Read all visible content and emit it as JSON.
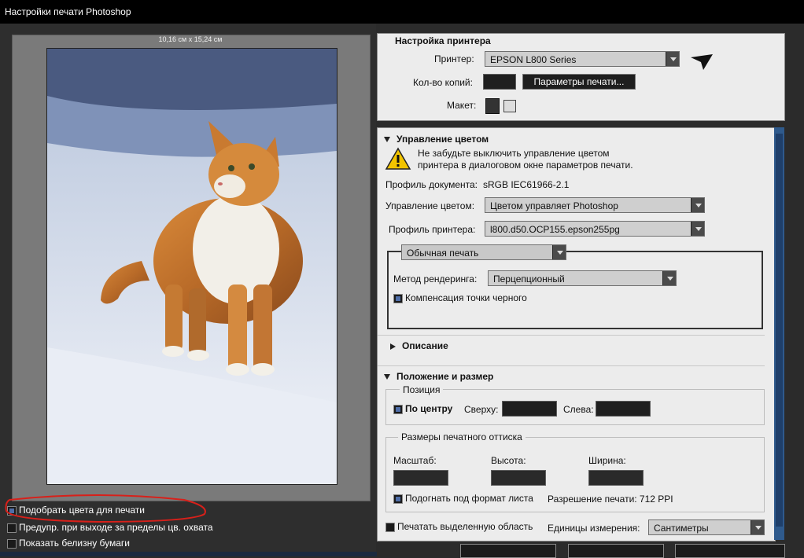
{
  "window": {
    "title": "Настройки печати Photoshop"
  },
  "preview": {
    "size_label": "10,16 см х 15,24 см"
  },
  "left_options": [
    {
      "label": "Подобрать цвета для печати",
      "checked": true
    },
    {
      "label": "Предупр. при выходе за пределы цв. охвата",
      "checked": false
    },
    {
      "label": "Показать белизну бумаги",
      "checked": false
    }
  ],
  "printer_setup": {
    "title": "Настройка принтера",
    "printer_label": "Принтер:",
    "printer_value": "EPSON L800 Series",
    "copies_label": "Кол-во копий:",
    "copies_value": "",
    "print_settings_button": "Параметры печати...",
    "layout_label": "Макет:"
  },
  "color_management": {
    "title": "Управление цветом",
    "warning": [
      "Не забудьте выключить управление цветом",
      "принтера в диалоговом окне параметров печати."
    ],
    "doc_profile_label": "Профиль документа:",
    "doc_profile_value": "sRGB IEC61966-2.1",
    "cm_label": "Управление цветом:",
    "cm_value": "Цветом управляет Photoshop",
    "printer_profile_label": "Профиль принтера:",
    "printer_profile_value": "l800.d50.OCP155.epson255pg",
    "print_mode_value": "Обычная печать",
    "render_label": "Метод рендеринга:",
    "render_value": "Перцепционный",
    "bpc_label": "Компенсация точки черного"
  },
  "description": {
    "title": "Описание"
  },
  "position_size": {
    "title": "Положение и размер",
    "position_group": "Позиция",
    "center_label": "По центру",
    "top_label": "Сверху:",
    "left_label": "Слева:",
    "print_size_group": "Размеры печатного оттиска",
    "scale_label": "Масштаб:",
    "height_label": "Высота:",
    "width_label": "Ширина:",
    "fit_label": "Подогнать под формат листа",
    "resolution_label": "Разрешение печати: 712 PPI",
    "print_selected_label": "Печатать выделенную область",
    "units_label": "Единицы измерения:",
    "units_value": "Сантиметры"
  }
}
